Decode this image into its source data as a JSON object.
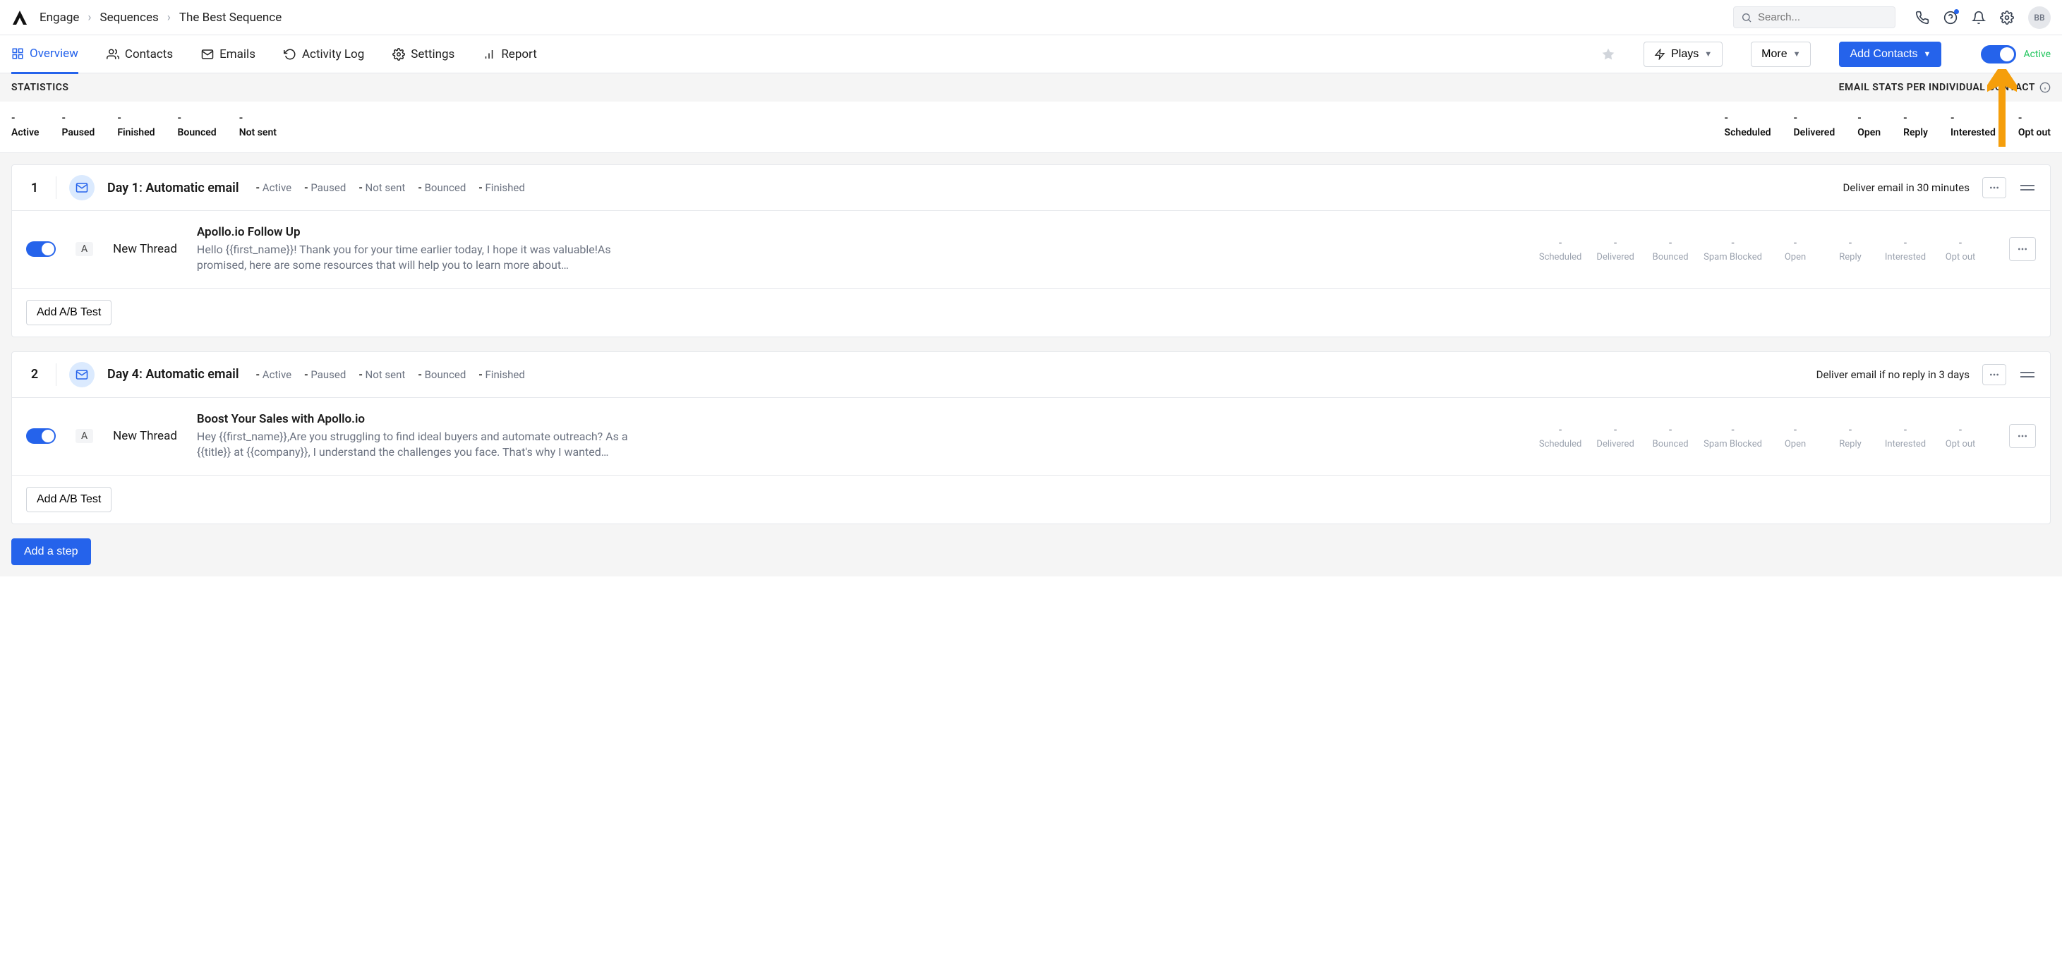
{
  "breadcrumb": {
    "engage": "Engage",
    "sequences": "Sequences",
    "name": "The Best Sequence"
  },
  "search": {
    "placeholder": "Search..."
  },
  "avatar": "BB",
  "nav": {
    "overview": "Overview",
    "contacts": "Contacts",
    "emails": "Emails",
    "activity": "Activity Log",
    "settings": "Settings",
    "report": "Report",
    "plays": "Plays",
    "more": "More",
    "add_contacts": "Add Contacts",
    "active": "Active"
  },
  "stats_header": {
    "left": "STATISTICS",
    "right": "EMAIL STATS PER INDIVIDUAL CONTACT"
  },
  "left_stats": {
    "items": [
      {
        "val": "-",
        "lbl": "Active"
      },
      {
        "val": "-",
        "lbl": "Paused"
      },
      {
        "val": "-",
        "lbl": "Finished"
      },
      {
        "val": "-",
        "lbl": "Bounced"
      },
      {
        "val": "-",
        "lbl": "Not sent"
      }
    ]
  },
  "right_stats": {
    "items": [
      {
        "val": "-",
        "lbl": "Scheduled"
      },
      {
        "val": "-",
        "lbl": "Delivered"
      },
      {
        "val": "-",
        "lbl": "Open"
      },
      {
        "val": "-",
        "lbl": "Reply"
      },
      {
        "val": "-",
        "lbl": "Interested"
      },
      {
        "val": "-",
        "lbl": "Opt out"
      }
    ]
  },
  "steps": [
    {
      "num": "1",
      "title": "Day 1: Automatic email",
      "mini_stats": [
        "Active",
        "Paused",
        "Not sent",
        "Bounced",
        "Finished"
      ],
      "deliver": "Deliver email in 30 minutes",
      "badge": "A",
      "thread": "New Thread",
      "subject": "Apollo.io Follow Up",
      "preview": "Hello {{first_name}}! Thank you for your time earlier today, I hope it was valuable!As promised, here are some resources that will help you to learn more about…",
      "thread_stats": [
        {
          "v": "-",
          "l": "Scheduled"
        },
        {
          "v": "-",
          "l": "Delivered"
        },
        {
          "v": "-",
          "l": "Bounced"
        },
        {
          "v": "-",
          "l": "Spam Blocked"
        },
        {
          "v": "-",
          "l": "Open"
        },
        {
          "v": "-",
          "l": "Reply"
        },
        {
          "v": "-",
          "l": "Interested"
        },
        {
          "v": "-",
          "l": "Opt out"
        }
      ],
      "ab": "Add A/B Test"
    },
    {
      "num": "2",
      "title": "Day 4: Automatic email",
      "mini_stats": [
        "Active",
        "Paused",
        "Not sent",
        "Bounced",
        "Finished"
      ],
      "deliver": "Deliver email if no reply in 3 days",
      "badge": "A",
      "thread": "New Thread",
      "subject": "Boost Your Sales with Apollo.io",
      "preview": "Hey {{first_name}},Are you struggling to find ideal buyers and automate outreach? As a {{title}} at {{company}}, I understand the challenges you face. That's why I wanted…",
      "thread_stats": [
        {
          "v": "-",
          "l": "Scheduled"
        },
        {
          "v": "-",
          "l": "Delivered"
        },
        {
          "v": "-",
          "l": "Bounced"
        },
        {
          "v": "-",
          "l": "Spam Blocked"
        },
        {
          "v": "-",
          "l": "Open"
        },
        {
          "v": "-",
          "l": "Reply"
        },
        {
          "v": "-",
          "l": "Interested"
        },
        {
          "v": "-",
          "l": "Opt out"
        }
      ],
      "ab": "Add A/B Test"
    }
  ],
  "add_step": "Add a step"
}
